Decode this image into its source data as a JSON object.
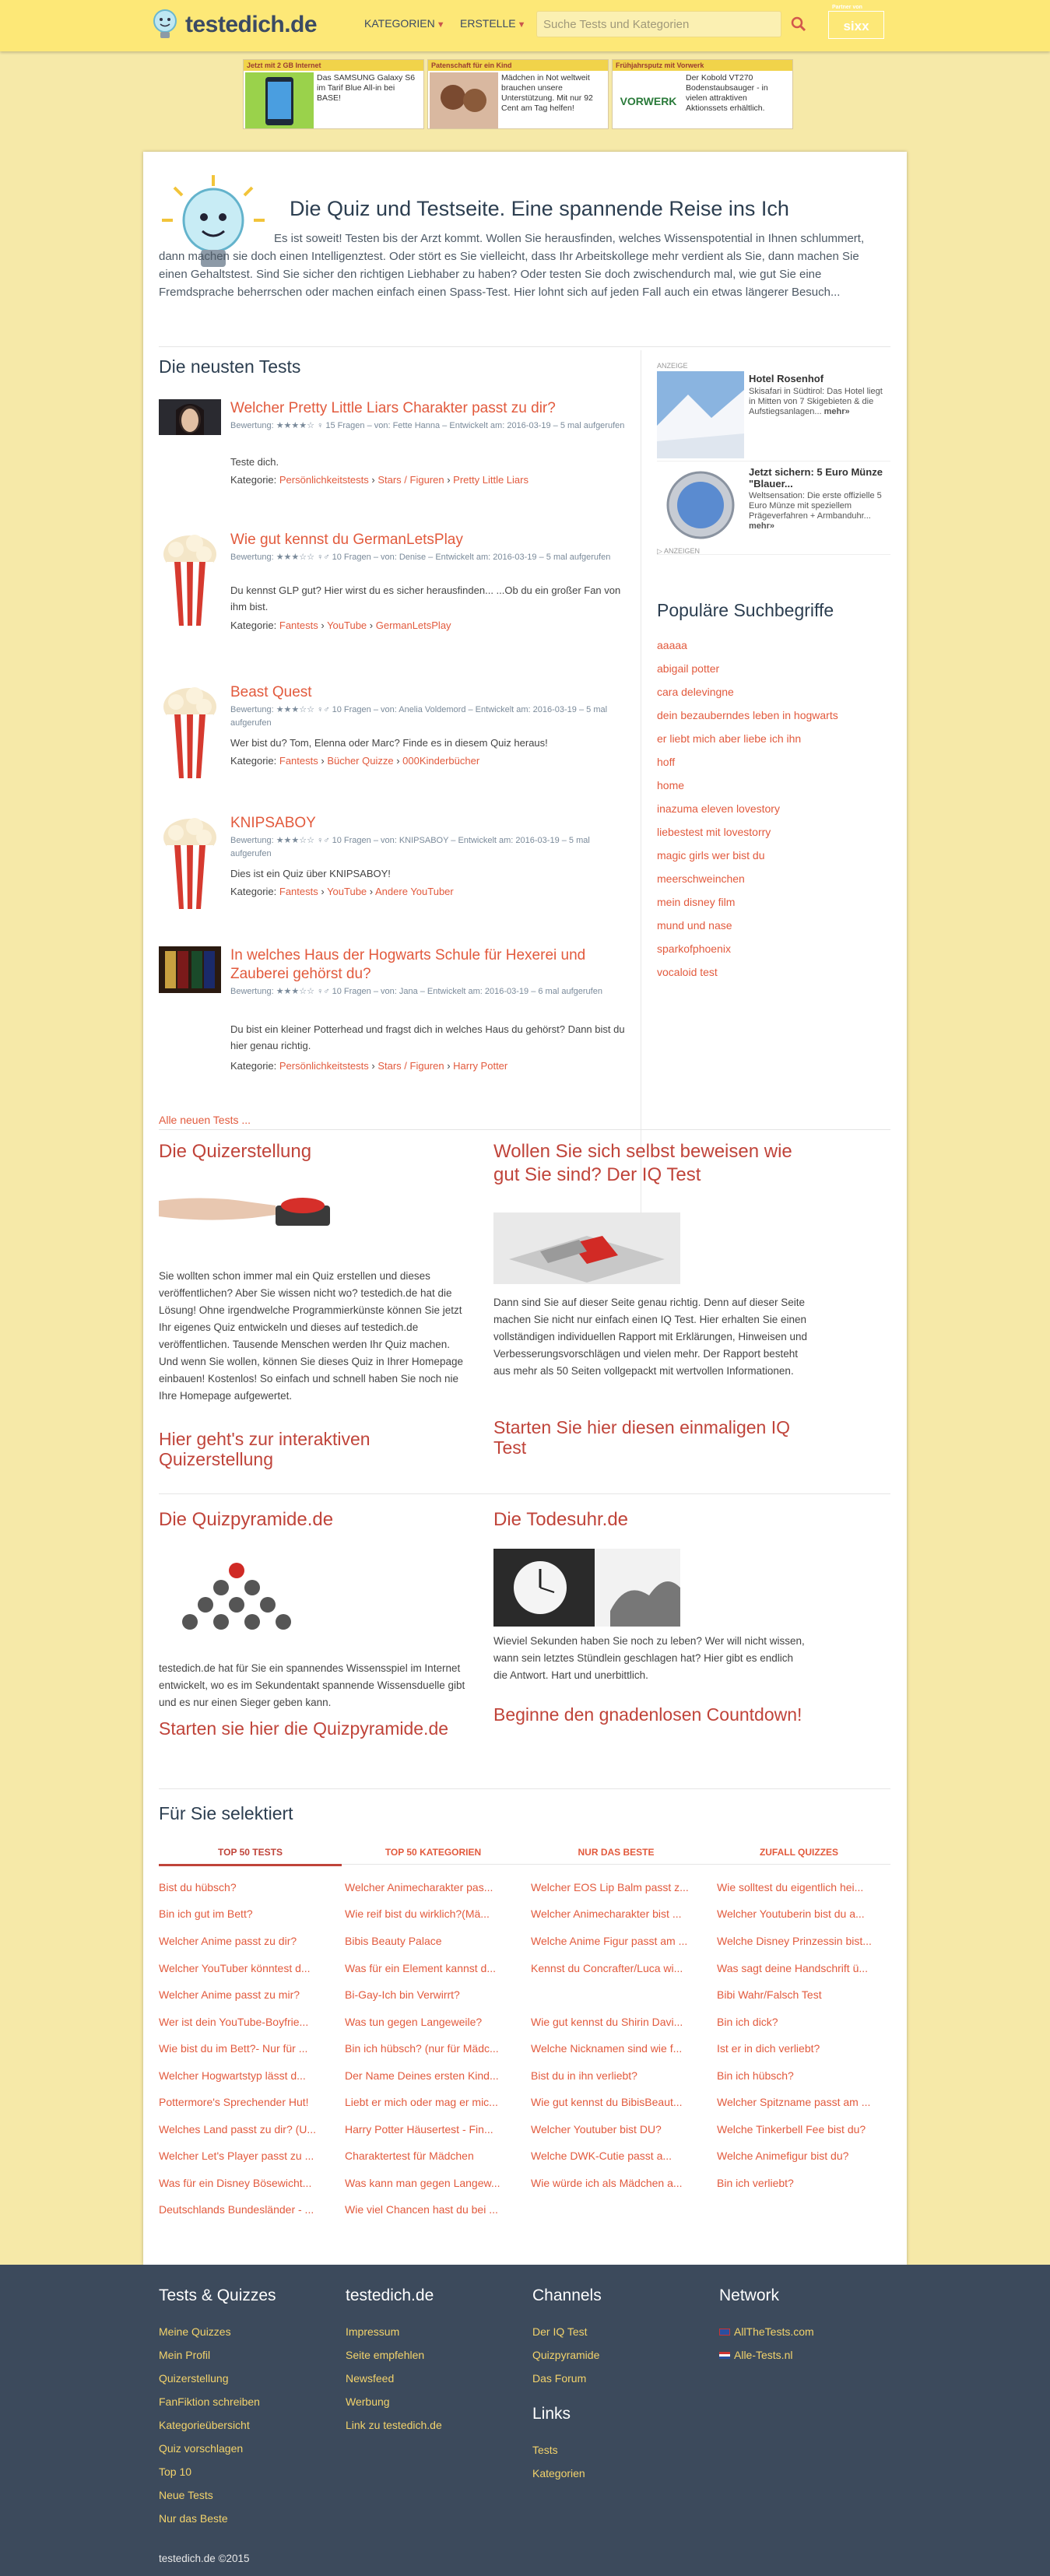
{
  "header": {
    "logo": "testedich.de",
    "nav": [
      "KATEGORIEN",
      "ERSTELLE"
    ],
    "search_placeholder": "Suche Tests und Kategorien",
    "partner": "sixx",
    "partner_note": "Partner von"
  },
  "ads": [
    {
      "head": "Jetzt mit 2 GB Internet",
      "text": "Das SAMSUNG Galaxy S6 im Tarif Blue All-in bei BASE!"
    },
    {
      "head": "Patenschaft für ein Kind",
      "text": "Mädchen in Not weltweit brauchen unsere Unterstützung. Mit nur 92 Cent am Tag helfen!"
    },
    {
      "head": "Frühjahrsputz mit Vorwerk",
      "text": "Der Kobold VT270 Bodenstaubsauger - in vielen attraktiven Aktionssets erhältlich.",
      "brand": "VORWERK"
    }
  ],
  "hero": {
    "title": "Die Quiz und Testseite. Eine spannende Reise ins Ich",
    "text": "Es ist soweit! Testen bis der Arzt kommt. Wollen Sie herausfinden, welches Wissenspotential in Ihnen schlummert, dann machen sie doch einen Intelligenztest. Oder stört es Sie vielleicht, dass Ihr Arbeitskollege mehr verdient als Sie, dann machen Sie einen Gehaltstest. Sind Sie sicher den richtigen Liebhaber zu haben? Oder testen Sie doch zwischendurch mal, wie gut Sie eine Fremdsprache beherrschen oder machen einfach einen Spass-Test. Hier lohnt sich auf jeden Fall auch ein etwas längerer Besuch..."
  },
  "newest": {
    "heading": "Die neusten Tests",
    "all_link": "Alle neuen Tests ...",
    "items": [
      {
        "title": "Welcher Pretty Little Liars Charakter passt zu dir?",
        "meta": "Bewertung: ★★★★☆ ♀ 15 Fragen – von: Fette Hanna – Entwickelt am: 2016-03-19 – 5 mal aufgerufen",
        "desc": "Teste dich.",
        "cat_label": "Kategorie:",
        "cats": [
          "Persönlichkeitstests",
          "Stars / Figuren",
          "Pretty Little Liars"
        ]
      },
      {
        "title": "Wie gut kennst du GermanLetsPlay",
        "meta": "Bewertung: ★★★☆☆ ♀♂ 10 Fragen – von: Denise – Entwickelt am: 2016-03-19 – 5 mal aufgerufen",
        "desc": "Du kennst GLP gut? Hier wirst du es sicher herausfinden... ...Ob du ein großer Fan von ihm bist.",
        "cat_label": "Kategorie:",
        "cats": [
          "Fantests",
          "YouTube",
          "GermanLetsPlay"
        ]
      },
      {
        "title": "Beast Quest",
        "meta": "Bewertung: ★★★☆☆ ♀♂ 10 Fragen – von: Anelia Voldemord – Entwickelt am: 2016-03-19 – 5 mal aufgerufen",
        "desc": "Wer bist du? Tom, Elenna oder Marc? Finde es in diesem Quiz heraus!",
        "cat_label": "Kategorie:",
        "cats": [
          "Fantests",
          "Bücher Quizze",
          "000Kinderbücher"
        ]
      },
      {
        "title": "KNIPSABOY",
        "meta": "Bewertung: ★★★☆☆ ♀♂ 10 Fragen – von: KNIPSABOY – Entwickelt am: 2016-03-19 – 5 mal aufgerufen",
        "desc": "Dies ist ein Quiz über KNIPSABOY!",
        "cat_label": "Kategorie:",
        "cats": [
          "Fantests",
          "YouTube",
          "Andere YouTuber"
        ]
      },
      {
        "title": "In welches Haus der Hogwarts Schule für Hexerei und Zauberei gehörst du?",
        "meta": "Bewertung: ★★★☆☆ ♀♂ 10 Fragen – von: Jana – Entwickelt am: 2016-03-19 – 6 mal aufgerufen",
        "desc": "Du bist ein kleiner Potterhead und fragst dich in welches Haus du gehörst? Dann bist du hier genau richtig.",
        "cat_label": "Kategorie:",
        "cats": [
          "Persönlichkeitstests",
          "Stars / Figuren",
          "Harry Potter"
        ]
      }
    ]
  },
  "side_ads": {
    "label": "ANZEIGE",
    "footer": "ANZEIGEN",
    "items": [
      {
        "title": "Hotel Rosenhof",
        "text": "Skisafari in Südtirol: Das Hotel liegt in Mitten von 7 Skigebieten & die Aufstiegsanlagen...",
        "more": "mehr»"
      },
      {
        "title": "Jetzt sichern: 5 Euro Münze \"Blauer...",
        "text": "Weltsensation: Die erste offizielle 5 Euro Münze mit speziellem Prägeverfahren + Armbanduhr...",
        "more": "mehr»"
      }
    ]
  },
  "popular": {
    "heading": "Populäre Suchbegriffe",
    "terms": [
      "aaaaa",
      "abigail potter",
      "cara delevingne",
      "dein bezauberndes leben in hogwarts",
      "er liebt mich aber liebe ich ihn",
      "hoff",
      "home",
      "inazuma eleven lovestory",
      "liebestest mit lovestorry",
      "magic girls wer bist du",
      "meerschweinchen",
      "mein disney film",
      "mund und nase",
      "sparkofphoenix",
      "vocaloid test"
    ]
  },
  "quizerstellung": {
    "heading": "Die Quizerstellung",
    "text": "Sie wollten schon immer mal ein Quiz erstellen und dieses veröffentlichen? Aber Sie wissen nicht wo? testedich.de hat die Lösung! Ohne irgendwelche Programmierkünste können Sie jetzt Ihr eigenes Quiz entwickeln und dieses auf testedich.de veröffentlichen. Tausende Menschen werden Ihr Quiz machen. Und wenn Sie wollen, können Sie dieses Quiz in Ihrer Homepage einbauen! Kostenlos! So einfach und schnell haben Sie noch nie Ihre Homepage aufgewertet.",
    "link": "Hier geht's zur interaktiven Quizerstellung"
  },
  "iq": {
    "heading": "Wollen Sie sich selbst beweisen wie gut Sie sind? Der IQ Test",
    "text": "Dann sind Sie auf dieser Seite genau richtig. Denn auf dieser Seite machen Sie nicht nur einfach einen IQ Test. Hier erhalten Sie einen vollständigen individuellen Rapport mit Erklärungen, Hinweisen und Verbesserungsvorschlägen und vielen mehr. Der Rapport besteht aus mehr als 50 Seiten vollgepackt mit wertvollen Informationen.",
    "link": "Starten Sie hier diesen einmaligen IQ Test"
  },
  "pyramide": {
    "heading": "Die Quizpyramide.de",
    "text": "testedich.de hat für Sie ein spannendes Wissensspiel im Internet entwickelt, wo es im Sekundentakt spannende Wissensduelle gibt und es nur einen Sieger geben kann.",
    "link": "Starten sie hier die Quizpyramide.de"
  },
  "todesuhr": {
    "heading": "Die Todesuhr.de",
    "text": "Wieviel Sekunden haben Sie noch zu leben? Wer will nicht wissen, wann sein letztes Stündlein geschlagen hat? Hier gibt es endlich die Antwort. Hart und unerbittlich.",
    "link": "Beginne den gnadenlosen Countdown!"
  },
  "selected": {
    "heading": "Für Sie selektiert",
    "tabs": [
      "TOP 50 TESTS",
      "TOP 50 KATEGORIEN",
      "NUR DAS BESTE",
      "ZUFALL QUIZZES"
    ],
    "columns": [
      [
        "Bist du hübsch?",
        "Bin ich gut im Bett?",
        "Welcher Anime passt zu dir?",
        "Welcher YouTuber könntest d...",
        "Welcher Anime passt zu mir?",
        "Wer ist dein YouTube-Boyfrie...",
        "Wie bist du im Bett?- Nur für ...",
        "Welcher Hogwartstyp lässt d...",
        "Pottermore's Sprechender Hut!",
        "Welches Land passt zu dir? (U...",
        "Welcher Let's Player passt zu ...",
        "Was für ein Disney Bösewicht...",
        "Deutschlands Bundesländer - ..."
      ],
      [
        "Welcher Animecharakter pas...",
        "Wie reif bist du wirklich?(Mä...",
        "Bibis Beauty Palace",
        "Was für ein Element kannst d...",
        "Bi-Gay-Ich bin Verwirrt?",
        "Was tun gegen Langeweile?",
        "Bin ich hübsch? (nur für Mädc...",
        "Der Name Deines ersten Kind...",
        "Liebt er mich oder mag er mic...",
        "Harry Potter Häusertest - Fin...",
        "Charaktertest für Mädchen",
        "Was kann man gegen Langew...",
        "Wie viel Chancen hast du bei ..."
      ],
      [
        "Welcher EOS Lip Balm passt z...",
        "Welcher Animecharakter bist ...",
        "Welche Anime Figur passt am ...",
        "Kennst du Concrafter/Luca wi...",
        "",
        "Wie gut kennst du Shirin Davi...",
        "Welche Nicknamen sind wie f...",
        "Bist du in ihn verliebt?",
        "Wie gut kennst du BibisBeaut...",
        "Welcher Youtuber bist DU?",
        "Welche DWK-Cutie passt a...",
        "Wie würde ich als Mädchen a..."
      ],
      [
        "Wie solltest du eigentlich hei...",
        "Welcher Youtuberin bist du a...",
        "Welche Disney Prinzessin bist...",
        "Was sagt deine Handschrift ü...",
        "Bibi Wahr/Falsch Test",
        "Bin ich dick?",
        "Ist er in dich verliebt?",
        "Bin ich hübsch?",
        "Welcher Spitzname passt am ...",
        "Welche Tinkerbell Fee bist du?",
        "Welche Animefigur bist du?",
        "Bin ich verliebt?"
      ]
    ]
  },
  "footer": {
    "cols": [
      {
        "heading": "Tests & Quizzes",
        "links": [
          "Meine Quizzes",
          "Mein Profil",
          "Quizerstellung",
          "FanFiktion schreiben",
          "Kategorieübersicht",
          "Quiz vorschlagen",
          "Top 10",
          "Neue Tests",
          "Nur das Beste"
        ]
      },
      {
        "heading": "testedich.de",
        "links": [
          "Impressum",
          "Seite empfehlen",
          "Newsfeed",
          "Werbung",
          "Link zu testedich.de"
        ]
      },
      {
        "heading": "Channels",
        "links": [
          "Der IQ Test",
          "Quizpyramide",
          "Das Forum"
        ]
      },
      {
        "heading": "Network",
        "links": [
          "AllTheTests.com",
          "Alle-Tests.nl"
        ]
      }
    ],
    "links_heading": "Links",
    "links_list": [
      "Tests",
      "Kategorien"
    ],
    "copyright": "testedich.de ©2015"
  }
}
